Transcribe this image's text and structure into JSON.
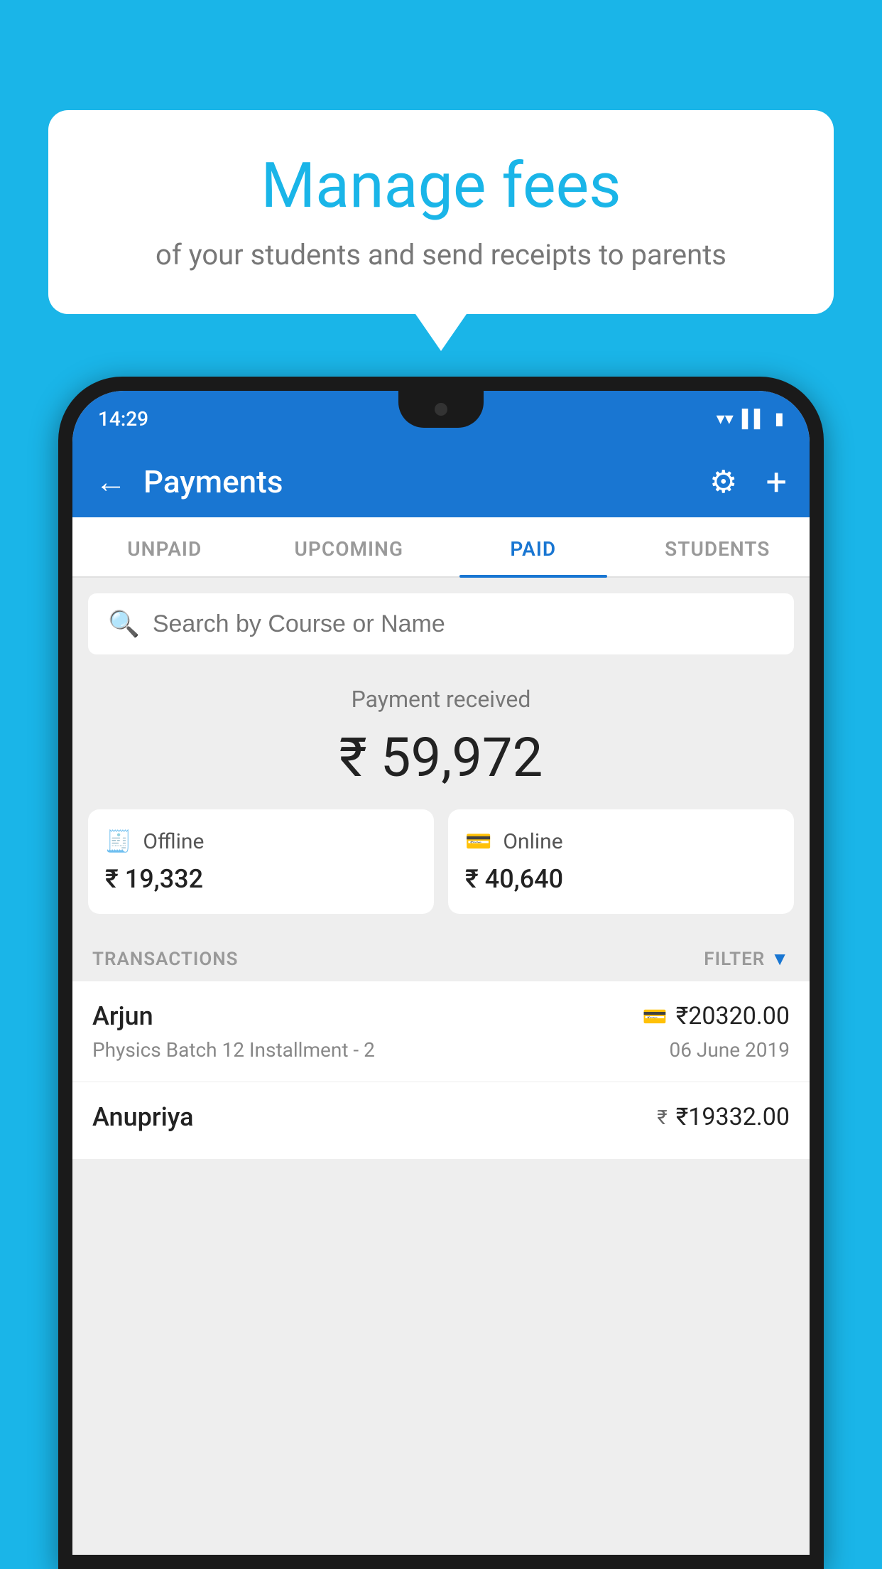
{
  "background_color": "#1ab5e8",
  "speech_bubble": {
    "title": "Manage fees",
    "subtitle": "of your students and send receipts to parents"
  },
  "phone": {
    "status_bar": {
      "time": "14:29",
      "icons": [
        "wifi",
        "signal",
        "battery"
      ]
    },
    "header": {
      "title": "Payments",
      "back_label": "←",
      "gear_label": "⚙",
      "plus_label": "+"
    },
    "tabs": [
      {
        "label": "UNPAID",
        "active": false
      },
      {
        "label": "UPCOMING",
        "active": false
      },
      {
        "label": "PAID",
        "active": true
      },
      {
        "label": "STUDENTS",
        "active": false
      }
    ],
    "search": {
      "placeholder": "Search by Course or Name"
    },
    "payment_summary": {
      "label": "Payment received",
      "amount": "₹ 59,972"
    },
    "payment_cards": [
      {
        "icon": "💳",
        "label": "Offline",
        "amount": "₹ 19,332"
      },
      {
        "icon": "💳",
        "label": "Online",
        "amount": "₹ 40,640"
      }
    ],
    "transactions_label": "TRANSACTIONS",
    "filter_label": "FILTER",
    "transactions": [
      {
        "name": "Arjun",
        "type_icon": "💳",
        "amount": "₹20320.00",
        "course": "Physics Batch 12 Installment - 2",
        "date": "06 June 2019"
      },
      {
        "name": "Anupriya",
        "type_icon": "₹",
        "amount": "₹19332.00",
        "course": "",
        "date": ""
      }
    ]
  }
}
